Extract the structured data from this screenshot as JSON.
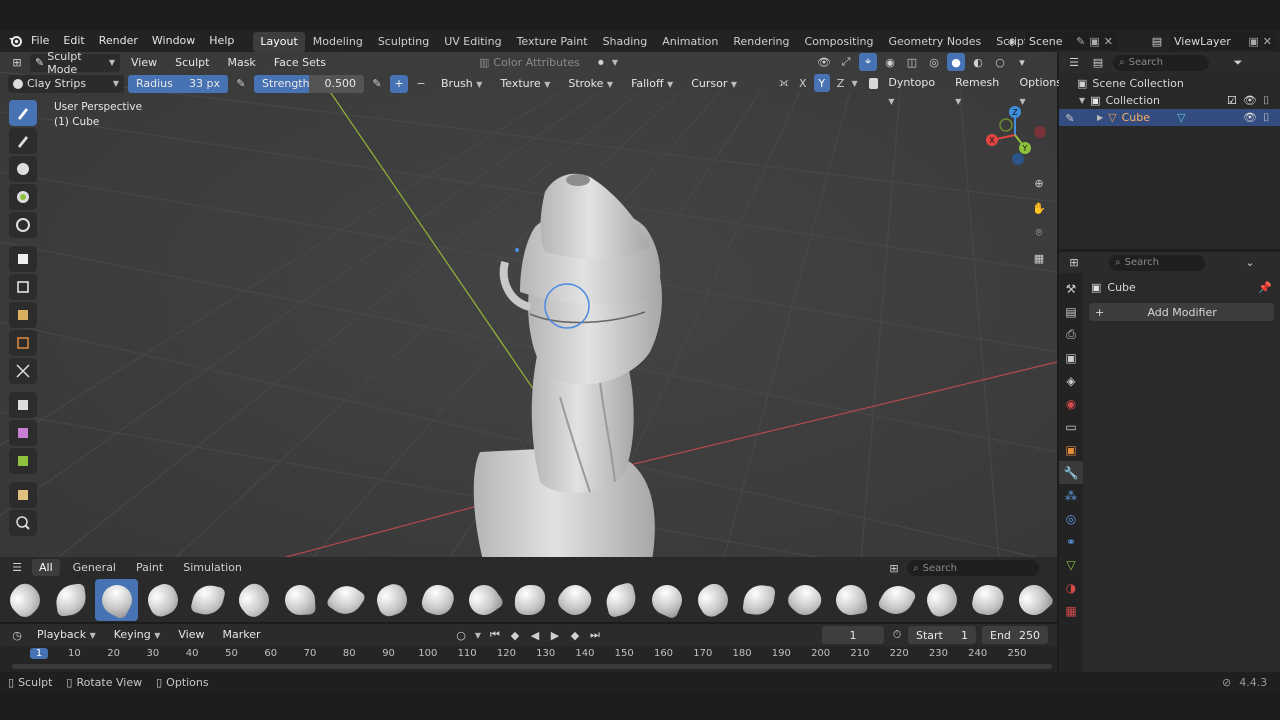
{
  "menu": {
    "items": [
      "File",
      "Edit",
      "Render",
      "Window",
      "Help"
    ],
    "workspaces": [
      "Layout",
      "Modeling",
      "Sculpting",
      "UV Editing",
      "Texture Paint",
      "Shading",
      "Animation",
      "Rendering",
      "Compositing",
      "Geometry Nodes",
      "Scripting"
    ],
    "active_workspace": "Layout",
    "scene": "Scene",
    "view_layer": "ViewLayer"
  },
  "viewport_header": {
    "mode": "Sculpt Mode",
    "menus": [
      "View",
      "Sculpt",
      "Mask",
      "Face Sets"
    ],
    "color_attributes": "Color Attributes"
  },
  "tool_header": {
    "brush_name": "Clay Strips",
    "radius_label": "Radius",
    "radius_value": "33 px",
    "strength_label": "Strength",
    "strength_value": "0.500",
    "plus": "+",
    "minus": "−",
    "menus": [
      "Brush",
      "Texture",
      "Stroke",
      "Falloff",
      "Cursor"
    ],
    "axes": [
      "X",
      "Y",
      "Z"
    ],
    "dyntopo": "Dyntopo",
    "remesh": "Remesh",
    "options": "Options"
  },
  "viewport": {
    "perspective": "User Perspective",
    "object": "(1) Cube",
    "gizmo": {
      "x": "X",
      "y": "Y",
      "z": "Z"
    }
  },
  "shelf": {
    "tabs": [
      "All",
      "General",
      "Paint",
      "Simulation"
    ],
    "active_tab": "All",
    "search_placeholder": "Search",
    "brush_count": 23,
    "active_brush_index": 2
  },
  "timeline": {
    "menus": [
      "Playback",
      "Keying",
      "View",
      "Marker"
    ],
    "current_frame": "1",
    "start_label": "Start",
    "start": "1",
    "end_label": "End",
    "end": "250",
    "ruler": [
      "1",
      "10",
      "20",
      "30",
      "40",
      "50",
      "60",
      "70",
      "80",
      "90",
      "100",
      "110",
      "120",
      "130",
      "140",
      "150",
      "160",
      "170",
      "180",
      "190",
      "200",
      "210",
      "220",
      "230",
      "240",
      "250"
    ]
  },
  "status": {
    "sculpt": "Sculpt",
    "rotate": "Rotate View",
    "options": "Options",
    "version": "4.4.3"
  },
  "outliner": {
    "search_placeholder": "Search",
    "scene_collection": "Scene Collection",
    "collection": "Collection",
    "cube": "Cube"
  },
  "properties": {
    "search_placeholder": "Search",
    "object_name": "Cube",
    "add_modifier": "Add Modifier"
  },
  "colors": {
    "accent": "#4772b3",
    "axis_x": "#e0463f",
    "axis_y": "#8fc23c",
    "axis_z": "#3f8fe0"
  }
}
